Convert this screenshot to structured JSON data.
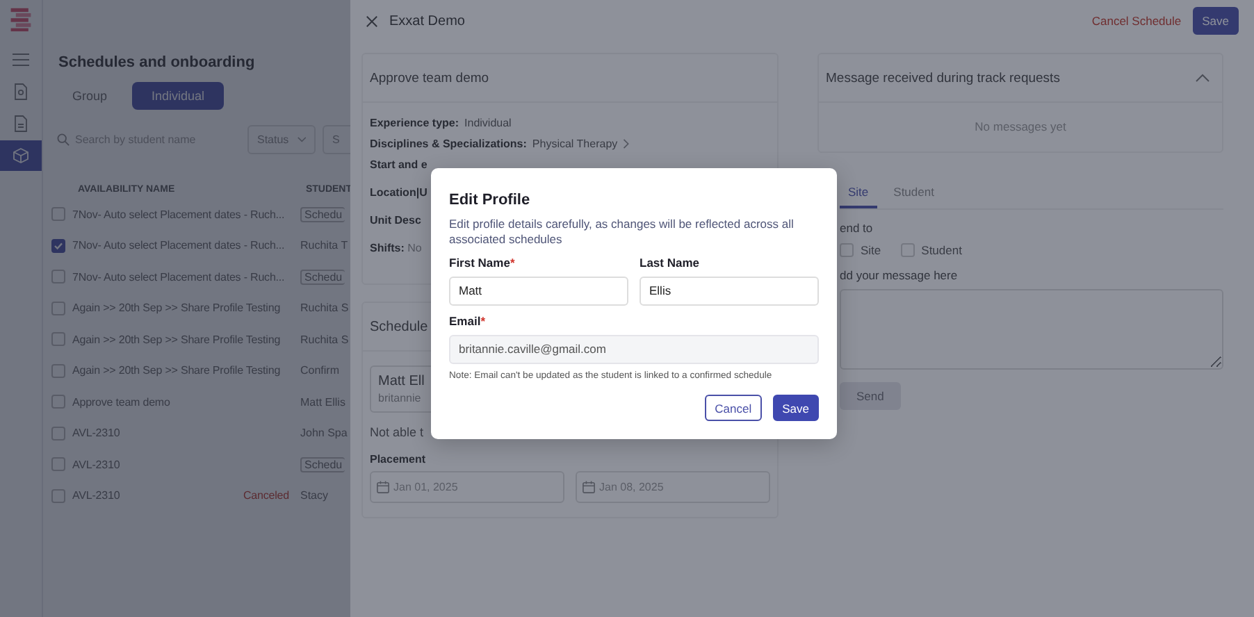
{
  "sidebar": {
    "items": [
      {
        "kind": "menu",
        "selected": false
      },
      {
        "kind": "search-doc",
        "selected": false
      },
      {
        "kind": "doc",
        "selected": false
      },
      {
        "kind": "box",
        "selected": true
      }
    ]
  },
  "page": {
    "title": "Schedules and onboarding",
    "tabs": [
      {
        "label": "Group",
        "selected": false
      },
      {
        "label": "Individual",
        "selected": true
      }
    ],
    "search": {
      "placeholder": "Search by student name"
    },
    "filters": [
      {
        "label": "Status"
      },
      {
        "label": "S"
      }
    ],
    "table": {
      "columns": [
        "AVAILABILITY NAME",
        "STUDENT"
      ],
      "rows": [
        {
          "name": "7Nov- Auto select Placement dates - Ruch...",
          "checked": false,
          "student": "Schedu",
          "outlined": true
        },
        {
          "name": "7Nov- Auto select Placement dates - Ruch...",
          "checked": true,
          "student": "Ruchita T",
          "outlined": false
        },
        {
          "name": "7Nov- Auto select Placement dates - Ruch...",
          "checked": false,
          "student": "Schedu",
          "outlined": true
        },
        {
          "name": "Again >> 20th Sep >> Share Profile Testing",
          "checked": false,
          "student": "Ruchita S",
          "outlined": false
        },
        {
          "name": "Again >> 20th Sep >> Share Profile Testing",
          "checked": false,
          "student": "Ruchita S",
          "outlined": false
        },
        {
          "name": "Again >> 20th Sep >> Share Profile Testing",
          "checked": false,
          "student": "Confirm",
          "outlined": false
        },
        {
          "name": "Approve team demo",
          "checked": false,
          "student": "Matt Ellis",
          "outlined": false
        },
        {
          "name": "AVL-2310",
          "checked": false,
          "student": "John Spa",
          "outlined": false
        },
        {
          "name": "AVL-2310",
          "checked": false,
          "student": "Schedu",
          "outlined": true
        },
        {
          "name": "AVL-2310",
          "checked": false,
          "status": "Canceled",
          "student": "Stacy",
          "outlined": false
        }
      ]
    }
  },
  "drawer": {
    "title": "Exxat Demo",
    "cancel_link": "Cancel Schedule",
    "save_button": "Save",
    "details": {
      "title": "Approve team demo",
      "fields": [
        {
          "label": "Experience type:",
          "value": "Individual",
          "link": false
        },
        {
          "label": "Disciplines & Specializations:",
          "value": "Physical Therapy",
          "link": true
        }
      ],
      "partial_rows": [
        "Start and e",
        "Location|U",
        "Unit Desc",
        "**Shifts:** No"
      ]
    },
    "schedule": {
      "title": "Schedule",
      "student": {
        "name": "Matt Ell",
        "email": "britannie"
      },
      "note": "Not able t",
      "placement_label": "Placement",
      "dates": [
        "Jan 01, 2025",
        "Jan 08, 2025"
      ]
    },
    "messages": {
      "title": "Message received during track requests",
      "expanded": true,
      "empty_text": "No messages yet"
    },
    "compose": {
      "tabs": [
        {
          "label": "Site",
          "selected": true
        },
        {
          "label": "Student",
          "selected": false
        }
      ],
      "send_to_label": "end to",
      "recipients": [
        {
          "label": "Site",
          "checked": false
        },
        {
          "label": "Student",
          "checked": false
        }
      ],
      "message_label": "dd your message here",
      "send_button": {
        "label": "Send",
        "disabled": true
      }
    }
  },
  "modal": {
    "title": "Edit Profile",
    "description": "Edit profile details carefully, as changes will be reflected across all associated schedules",
    "fields": [
      {
        "label": "First Name",
        "mark": "*",
        "value": "Matt",
        "disabled": false
      },
      {
        "label": "Last Name",
        "value": "Ellis",
        "disabled": false
      },
      {
        "label": "Email",
        "mark": "*",
        "value": "britannie.caville@gmail.com",
        "disabled": true
      }
    ],
    "note": "Note: Email can't be updated as the student is linked to a confirmed schedule",
    "buttons": [
      {
        "label": "Cancel",
        "kind": "secondary"
      },
      {
        "label": "Save",
        "kind": "primary"
      }
    ]
  }
}
